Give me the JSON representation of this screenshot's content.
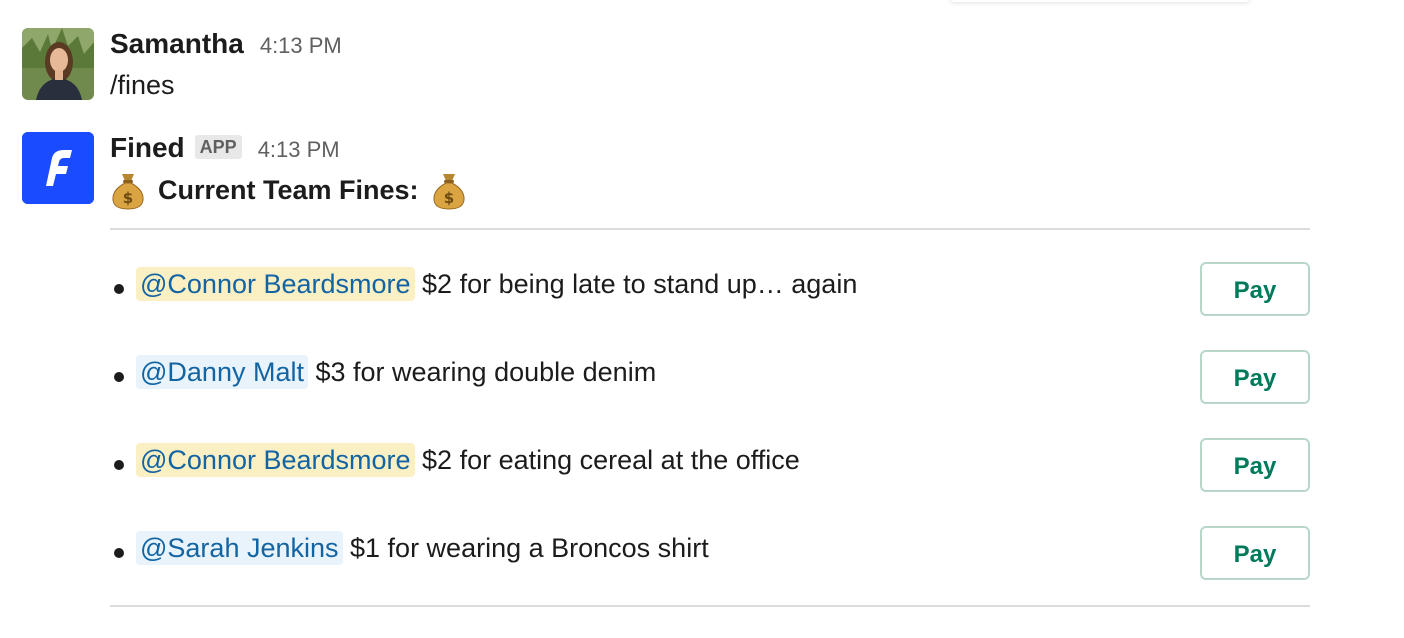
{
  "messages": [
    {
      "sender": "Samantha",
      "time": "4:13 PM",
      "text": "/fines"
    },
    {
      "sender": "Fined",
      "badge": "APP",
      "time": "4:13 PM",
      "title_prefix_icon": "money-bag-icon",
      "title": "Current Team Fines:",
      "title_suffix_icon": "money-bag-icon",
      "fines": [
        {
          "mention": "@Connor Beardsmore",
          "text": " $2 for being late to stand up… again",
          "highlighted": true,
          "button": "Pay"
        },
        {
          "mention": "@Danny Malt",
          "text": " $3 for wearing double denim",
          "highlighted": false,
          "button": "Pay"
        },
        {
          "mention": "@Connor Beardsmore",
          "text": " $2 for eating cereal at the office",
          "highlighted": true,
          "button": "Pay"
        },
        {
          "mention": "@Sarah Jenkins",
          "text": " $1 for wearing a Broncos shirt",
          "highlighted": false,
          "button": "Pay"
        }
      ]
    }
  ],
  "colors": {
    "mention_text": "#1264a3",
    "mention_self_bg": "#fbefc4",
    "mention_other_bg": "#e8f3fb",
    "pay_button_text": "#007a5a",
    "app_logo_bg": "#1a4bff"
  }
}
